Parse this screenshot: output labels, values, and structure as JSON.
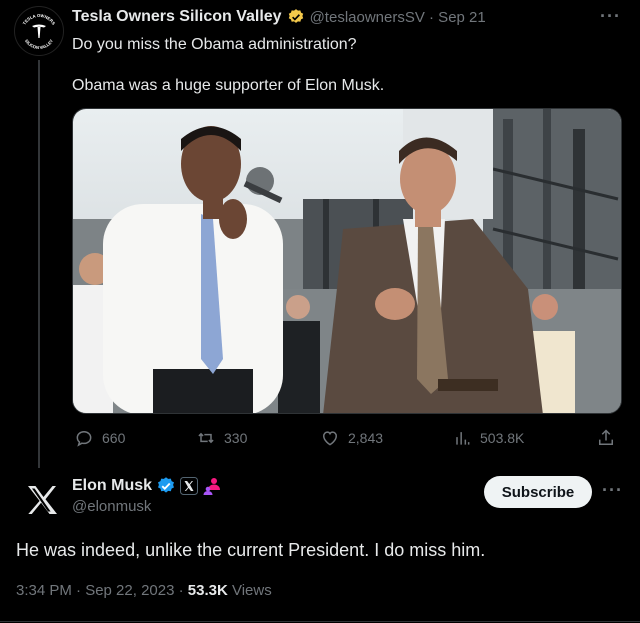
{
  "tweet1": {
    "avatar_text_top": "TESLA OWNERS",
    "avatar_text_bottom": "SILICON VALLEY",
    "author_name": "Tesla Owners Silicon Valley",
    "handle_date": "@teslaownersSV · Sep 21",
    "line1": "Do you miss the Obama administration?",
    "line2": "Obama was a huge supporter of Elon Musk.",
    "more_label": "···",
    "replies": "660",
    "reposts": "330",
    "likes": "2,843",
    "views": "503.8K"
  },
  "tweet2": {
    "author_name": "Elon Musk",
    "handle": "@elonmusk",
    "subscribe_label": "Subscribe",
    "more_label": "···",
    "text": "He was indeed, unlike the current President. I do miss him.",
    "time_date": "3:34 PM · Sep 22, 2023 · ",
    "views_count": "53.3K",
    "views_label": " Views"
  },
  "colors": {
    "background": "#000000",
    "verified_gold": "#f4c94b",
    "verified_blue": "#1d9bf0",
    "muted": "#71767b",
    "text": "#e7e9ea"
  }
}
